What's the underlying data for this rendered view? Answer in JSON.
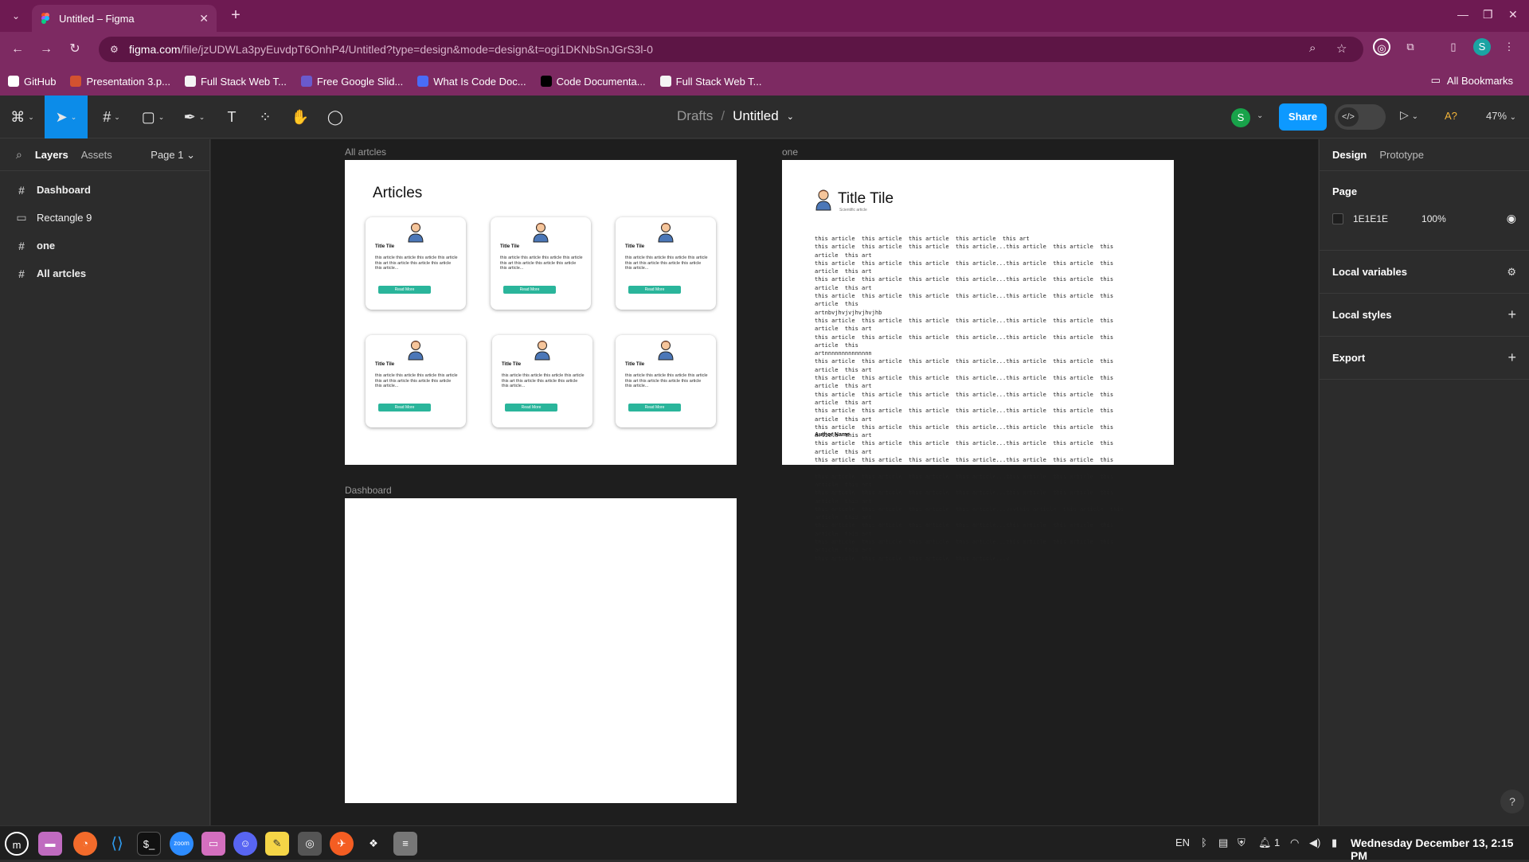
{
  "browser": {
    "tab_title": "Untitled – Figma",
    "url_host": "figma.com",
    "url_path": "/file/jzUDWLa3pyEuvdpT6OnhP4/Untitled?type=design&mode=design&t=ogi1DKNbSnJGrS3l-0",
    "new_tab": "+",
    "bookmarks": [
      {
        "label": "GitHub",
        "color": "#ffffff"
      },
      {
        "label": "Presentation 3.p...",
        "color": "#d35230"
      },
      {
        "label": "Full Stack Web T...",
        "color": "#f4f4f4"
      },
      {
        "label": "Free Google Slid...",
        "color": "#6a5acd"
      },
      {
        "label": "What Is Code Doc...",
        "color": "#4a6cf7"
      },
      {
        "label": "Code Documenta...",
        "color": "#000000"
      },
      {
        "label": "Full Stack Web T...",
        "color": "#f4f4f4"
      }
    ],
    "all_bookmarks": "All Bookmarks",
    "profile_initial": "S"
  },
  "figma": {
    "breadcrumb_drafts": "Drafts",
    "breadcrumb_sep": "/",
    "file_name": "Untitled",
    "user_initial": "S",
    "share_label": "Share",
    "font_warning": "A?",
    "zoom": "47%",
    "left_panel": {
      "tab_layers": "Layers",
      "tab_assets": "Assets",
      "page_select": "Page 1",
      "layers": [
        {
          "name": "Dashboard",
          "icon": "#",
          "bold": true
        },
        {
          "name": "Rectangle 9",
          "icon": "▭",
          "bold": false
        },
        {
          "name": "one",
          "icon": "#",
          "bold": true
        },
        {
          "name": "All artcles",
          "icon": "#",
          "bold": true
        }
      ]
    },
    "canvas": {
      "label_all": "All artcles",
      "label_one": "one",
      "label_dashboard": "Dashboard",
      "articles_heading": "Articles",
      "card_title": "Title Tile",
      "card_body": "this article  this article  this article this article  this art this article  this article  this article this article...",
      "card_button": "Read More",
      "one_title": "Title Tile",
      "one_subtitle": "Scientific article",
      "one_body": "this article  this article  this article  this article  this art\nthis article  this article  this article  this article...this article  this article  this article  this art\nthis article  this article  this article  this article...this article  this article  this article  this art\nthis article  this article  this article  this article...this article  this article  this article  this art\nthis article  this article  this article  this article...this article  this article  this article  this\nartnbvjhvjvjhvjhvjhb\nthis article  this article  this article  this article...this article  this article  this article  this art\nthis article  this article  this article  this article...this article  this article  this article  this\nartnnnnnnnnnnnnnn\nthis article  this article  this article  this article...this article  this article  this article  this art\nthis article  this article  this article  this article...this article  this article  this article  this art\nthis article  this article  this article  this article...this article  this article  this article  this art\nthis article  this article  this article  this article...this article  this article  this article  this art\nthis article  this article  this article  this article...this article  this article  this article  this art\nthis article  this article  this article  this article...this article  this article  this article  this art\nthis article  this article  this article  this article...this article  this article  this article  this art\nthis article  this article  this article  this article...this article  this article  this article  this art\nthis article  this article  this article  this article...this article  this article  this article  this art\nthis article  this article  this article  this article...vvvthis article  this article  this article  this art\nthis article  this article  this article  this article...this article  this article  this article  this art\nthis article  this article  this article  this article...this article  this article  this article  this art\nthis article  this article  this article  this article...v",
      "one_author": "Author Name"
    },
    "right_panel": {
      "tab_design": "Design",
      "tab_prototype": "Prototype",
      "page_label": "Page",
      "page_color": "1E1E1E",
      "page_opacity": "100%",
      "local_variables": "Local variables",
      "local_styles": "Local styles",
      "export": "Export"
    }
  },
  "taskbar": {
    "lang": "EN",
    "notif_count": "1",
    "clock": "Wednesday December 13, 2:15 PM"
  },
  "colors": {
    "figma_blue": "#0d99ff",
    "chrome_purple": "#7d2a62",
    "read_more": "#2ab59b"
  }
}
